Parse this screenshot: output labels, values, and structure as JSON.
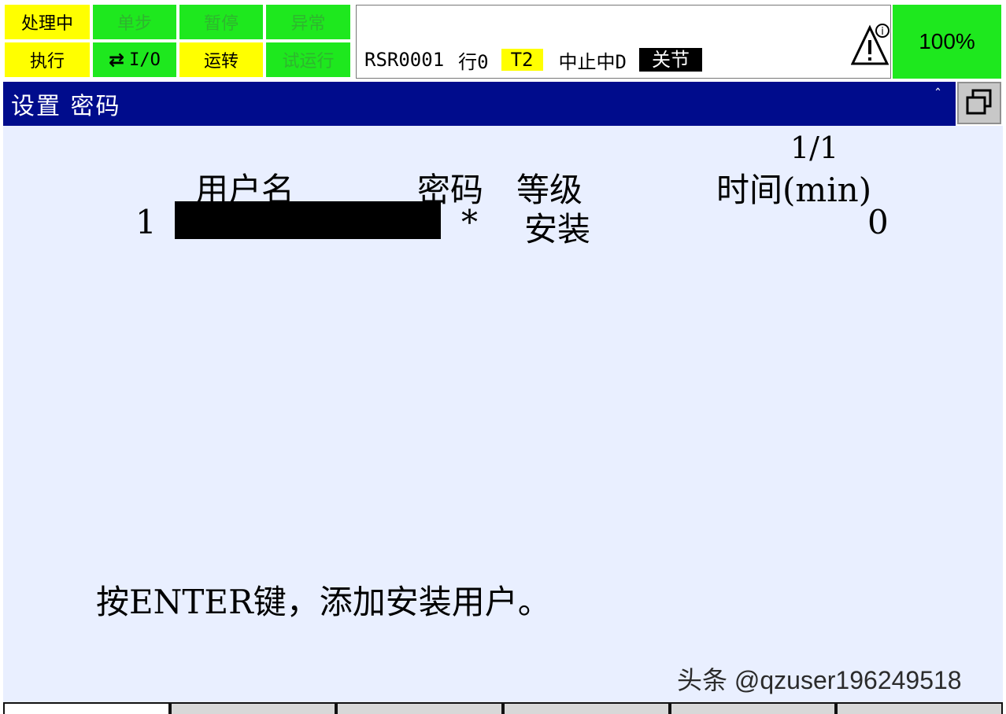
{
  "status_cells": {
    "busy": "处理中",
    "step": "单步",
    "hold": "暂停",
    "fault": "异常",
    "run": "执行",
    "io": "I/O",
    "prod": "运转",
    "tcyc": "试运行"
  },
  "status_bar": {
    "program": "RSR0001",
    "line": "行0",
    "mode": "T2",
    "state": "中止中D",
    "coord": "关节",
    "override": "100%"
  },
  "title": "设置 密码",
  "title_caret": "ˆ",
  "content": {
    "page": "1/1",
    "headers": {
      "username": "用户名",
      "password": "密码",
      "level": "等级",
      "time": "时间(min)"
    },
    "rows": [
      {
        "index": "1",
        "password": "*",
        "level": "安装",
        "time": "0"
      }
    ],
    "prompt": "按ENTER键，添加安装用户。"
  },
  "watermark": "头条 @qzuser196249518",
  "colors": {
    "title_bar": "#000c8c",
    "content_bg": "#e9efff",
    "status_yellow": "#ffff00",
    "status_green": "#1ee81e"
  }
}
